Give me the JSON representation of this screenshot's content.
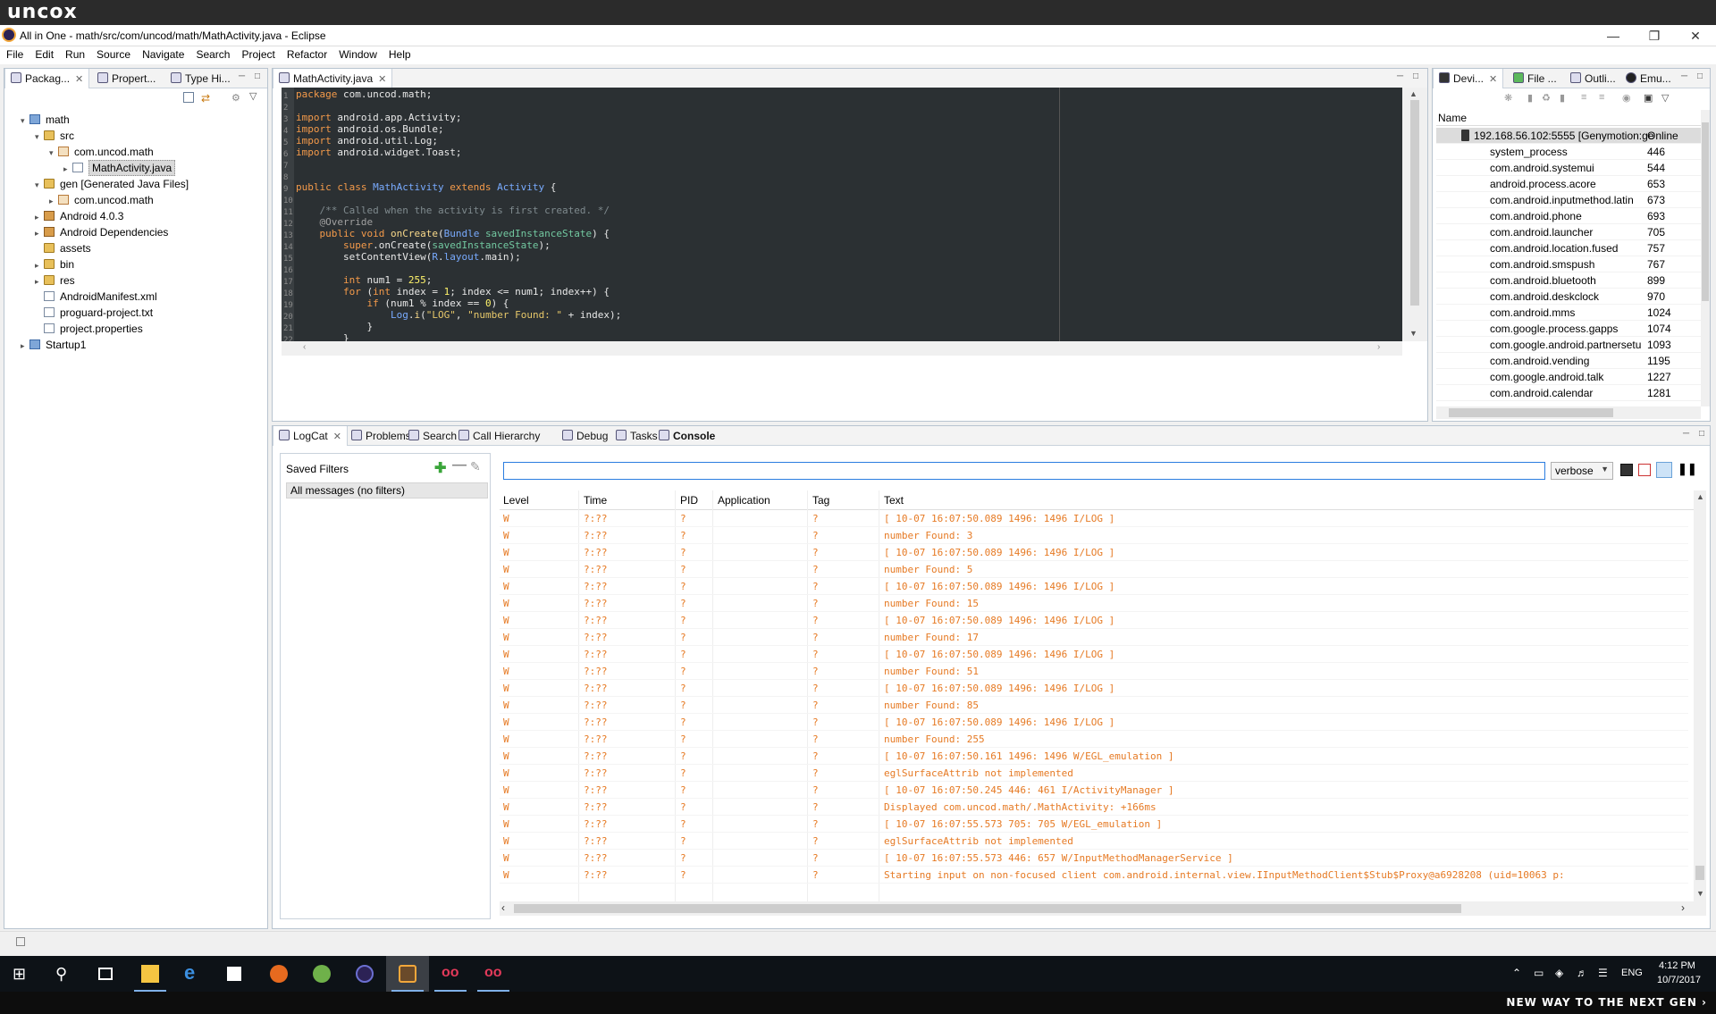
{
  "brand": {
    "logo": "uncox",
    "slogan": "NEW WAY TO THE NEXT GEN ›"
  },
  "window": {
    "title": "All in One - math/src/com/uncod/math/MathActivity.java - Eclipse"
  },
  "menu": [
    "File",
    "Edit",
    "Run",
    "Source",
    "Navigate",
    "Search",
    "Project",
    "Refactor",
    "Window",
    "Help"
  ],
  "left_tabs": [
    "Packag...",
    "Propert...",
    "Type Hi..."
  ],
  "tree": [
    {
      "label": "math",
      "depth": 0,
      "icon": "proj",
      "arrow": "▾"
    },
    {
      "label": "src",
      "depth": 1,
      "icon": "folder",
      "arrow": "▾"
    },
    {
      "label": "com.uncod.math",
      "depth": 2,
      "icon": "pkg",
      "arrow": "▾"
    },
    {
      "label": "MathActivity.java",
      "depth": 3,
      "icon": "file",
      "arrow": "▸",
      "selected": true
    },
    {
      "label": "gen [Generated Java Files]",
      "depth": 1,
      "icon": "folder",
      "arrow": "▾"
    },
    {
      "label": "com.uncod.math",
      "depth": 2,
      "icon": "pkg",
      "arrow": "▸"
    },
    {
      "label": "Android 4.0.3",
      "depth": 1,
      "icon": "lib",
      "arrow": "▸"
    },
    {
      "label": "Android Dependencies",
      "depth": 1,
      "icon": "lib",
      "arrow": "▸"
    },
    {
      "label": "assets",
      "depth": 1,
      "icon": "folder",
      "arrow": ""
    },
    {
      "label": "bin",
      "depth": 1,
      "icon": "folder",
      "arrow": "▸"
    },
    {
      "label": "res",
      "depth": 1,
      "icon": "folder",
      "arrow": "▸"
    },
    {
      "label": "AndroidManifest.xml",
      "depth": 1,
      "icon": "file",
      "arrow": ""
    },
    {
      "label": "proguard-project.txt",
      "depth": 1,
      "icon": "file",
      "arrow": ""
    },
    {
      "label": "project.properties",
      "depth": 1,
      "icon": "file",
      "arrow": ""
    },
    {
      "label": "Startup1",
      "depth": 0,
      "icon": "proj",
      "arrow": "▸"
    }
  ],
  "editor": {
    "tab": "MathActivity.java",
    "lines": [
      [
        [
          "kw",
          "package"
        ],
        [
          "",
          " com.uncod.math;"
        ]
      ],
      [],
      [
        [
          "kw",
          "import"
        ],
        [
          "",
          " android.app.Activity;"
        ]
      ],
      [
        [
          "kw",
          "import"
        ],
        [
          "",
          " android.os.Bundle;"
        ]
      ],
      [
        [
          "kw",
          "import"
        ],
        [
          "",
          " android.util.Log;"
        ]
      ],
      [
        [
          "kw",
          "import"
        ],
        [
          "",
          " android.widget.Toast;"
        ]
      ],
      [],
      [],
      [
        [
          "kw",
          "public class "
        ],
        [
          "ty",
          "MathActivity "
        ],
        [
          "kw",
          "extends "
        ],
        [
          "ty",
          "Activity"
        ],
        [
          "",
          " {"
        ]
      ],
      [],
      [
        [
          "cm",
          "    /** Called when the activity is first created. */"
        ]
      ],
      [
        [
          "an",
          "    @Override"
        ]
      ],
      [
        [
          "kw",
          "    public void "
        ],
        [
          "mt",
          "onCreate"
        ],
        [
          "",
          "("
        ],
        [
          "ty",
          "Bundle "
        ],
        [
          "fd",
          "savedInstanceState"
        ],
        [
          "",
          ") {"
        ]
      ],
      [
        [
          "kw",
          "        super"
        ],
        [
          "",
          ".onCreate("
        ],
        [
          "fd",
          "savedInstanceState"
        ],
        [
          "",
          ");"
        ]
      ],
      [
        [
          "",
          "        setContentView("
        ],
        [
          "ty",
          "R"
        ],
        [
          "",
          "."
        ],
        [
          "ty",
          "layout"
        ],
        [
          "",
          ".main);"
        ]
      ],
      [],
      [
        [
          "kw",
          "        int "
        ],
        [
          "",
          "num1 = "
        ],
        [
          "nm",
          "255"
        ],
        [
          "",
          ";"
        ]
      ],
      [
        [
          "kw",
          "        for "
        ],
        [
          "",
          "("
        ],
        [
          "kw",
          "int "
        ],
        [
          "",
          "index = "
        ],
        [
          "nm",
          "1"
        ],
        [
          "",
          "; index <= num1; index++) {"
        ]
      ],
      [
        [
          "kw",
          "            if "
        ],
        [
          "",
          "(num1 % index == "
        ],
        [
          "nm",
          "0"
        ],
        [
          "",
          ") {"
        ]
      ],
      [
        [
          "ty",
          "                Log"
        ],
        [
          "",
          "."
        ],
        [
          "mt",
          "i"
        ],
        [
          "",
          "("
        ],
        [
          "st",
          "\"LOG\""
        ],
        [
          "",
          ", "
        ],
        [
          "st",
          "\"number Found: \""
        ],
        [
          "",
          " + index);"
        ]
      ],
      [
        [
          "",
          "            }"
        ]
      ],
      [
        [
          "",
          "        }"
        ]
      ]
    ]
  },
  "devices": {
    "tabs": [
      "Devi...",
      "File ...",
      "Outli...",
      "Emu..."
    ],
    "header": "Name",
    "device": {
      "name": "192.168.56.102:5555 [Genymotion:ge",
      "status": "Online"
    },
    "processes": [
      {
        "name": "system_process",
        "pid": "446"
      },
      {
        "name": "com.android.systemui",
        "pid": "544"
      },
      {
        "name": "android.process.acore",
        "pid": "653"
      },
      {
        "name": "com.android.inputmethod.latin",
        "pid": "673"
      },
      {
        "name": "com.android.phone",
        "pid": "693"
      },
      {
        "name": "com.android.launcher",
        "pid": "705"
      },
      {
        "name": "com.android.location.fused",
        "pid": "757"
      },
      {
        "name": "com.android.smspush",
        "pid": "767"
      },
      {
        "name": "com.android.bluetooth",
        "pid": "899"
      },
      {
        "name": "com.android.deskclock",
        "pid": "970"
      },
      {
        "name": "com.android.mms",
        "pid": "1024"
      },
      {
        "name": "com.google.process.gapps",
        "pid": "1074"
      },
      {
        "name": "com.google.android.partnersetu",
        "pid": "1093"
      },
      {
        "name": "com.android.vending",
        "pid": "1195"
      },
      {
        "name": "com.google.android.talk",
        "pid": "1227"
      },
      {
        "name": "com.android.calendar",
        "pid": "1281"
      }
    ]
  },
  "bottom_tabs": [
    "LogCat",
    "Problems",
    "Search",
    "Call Hierarchy",
    "Debug",
    "Tasks",
    "Console"
  ],
  "logcat": {
    "saved_filters_label": "Saved Filters",
    "filter_item": "All messages (no filters)",
    "search_value": "",
    "level_select": "verbose",
    "columns": [
      "Level",
      "Time",
      "PID",
      "Application",
      "Tag",
      "Text"
    ],
    "rows": [
      [
        "W",
        "?:??",
        "?",
        "",
        "?",
        "[ 10-07 16:07:50.089  1496: 1496 I/LOG      ]"
      ],
      [
        "W",
        "?:??",
        "?",
        "",
        "?",
        "number Found: 3"
      ],
      [
        "W",
        "?:??",
        "?",
        "",
        "?",
        "[ 10-07 16:07:50.089  1496: 1496 I/LOG      ]"
      ],
      [
        "W",
        "?:??",
        "?",
        "",
        "?",
        "number Found: 5"
      ],
      [
        "W",
        "?:??",
        "?",
        "",
        "?",
        "[ 10-07 16:07:50.089  1496: 1496 I/LOG      ]"
      ],
      [
        "W",
        "?:??",
        "?",
        "",
        "?",
        "number Found: 15"
      ],
      [
        "W",
        "?:??",
        "?",
        "",
        "?",
        "[ 10-07 16:07:50.089  1496: 1496 I/LOG      ]"
      ],
      [
        "W",
        "?:??",
        "?",
        "",
        "?",
        "number Found: 17"
      ],
      [
        "W",
        "?:??",
        "?",
        "",
        "?",
        "[ 10-07 16:07:50.089  1496: 1496 I/LOG      ]"
      ],
      [
        "W",
        "?:??",
        "?",
        "",
        "?",
        "number Found: 51"
      ],
      [
        "W",
        "?:??",
        "?",
        "",
        "?",
        "[ 10-07 16:07:50.089  1496: 1496 I/LOG      ]"
      ],
      [
        "W",
        "?:??",
        "?",
        "",
        "?",
        "number Found: 85"
      ],
      [
        "W",
        "?:??",
        "?",
        "",
        "?",
        "[ 10-07 16:07:50.089  1496: 1496 I/LOG      ]"
      ],
      [
        "W",
        "?:??",
        "?",
        "",
        "?",
        "number Found: 255"
      ],
      [
        "W",
        "?:??",
        "?",
        "",
        "?",
        "[ 10-07 16:07:50.161  1496: 1496 W/EGL_emulation ]"
      ],
      [
        "W",
        "?:??",
        "?",
        "",
        "?",
        "eglSurfaceAttrib not implemented"
      ],
      [
        "W",
        "?:??",
        "?",
        "",
        "?",
        "[ 10-07 16:07:50.245   446:  461 I/ActivityManager ]"
      ],
      [
        "W",
        "?:??",
        "?",
        "",
        "?",
        "Displayed com.uncod.math/.MathActivity: +166ms"
      ],
      [
        "W",
        "?:??",
        "?",
        "",
        "?",
        "[ 10-07 16:07:55.573   705:  705 W/EGL_emulation ]"
      ],
      [
        "W",
        "?:??",
        "?",
        "",
        "?",
        "eglSurfaceAttrib not implemented"
      ],
      [
        "W",
        "?:??",
        "?",
        "",
        "?",
        "[ 10-07 16:07:55.573   446:  657 W/InputMethodManagerService ]"
      ],
      [
        "W",
        "?:??",
        "?",
        "",
        "?",
        "Starting input on non-focused client com.android.internal.view.IInputMethodClient$Stub$Proxy@a6928208 (uid=10063 p:"
      ]
    ]
  },
  "systray": {
    "lang": "ENG",
    "time": "4:12 PM",
    "date": "10/7/2017"
  },
  "colors": {
    "log_warn": "#e67a24",
    "editor_bg": "#2b3033",
    "taskbar": "#0d1217"
  }
}
